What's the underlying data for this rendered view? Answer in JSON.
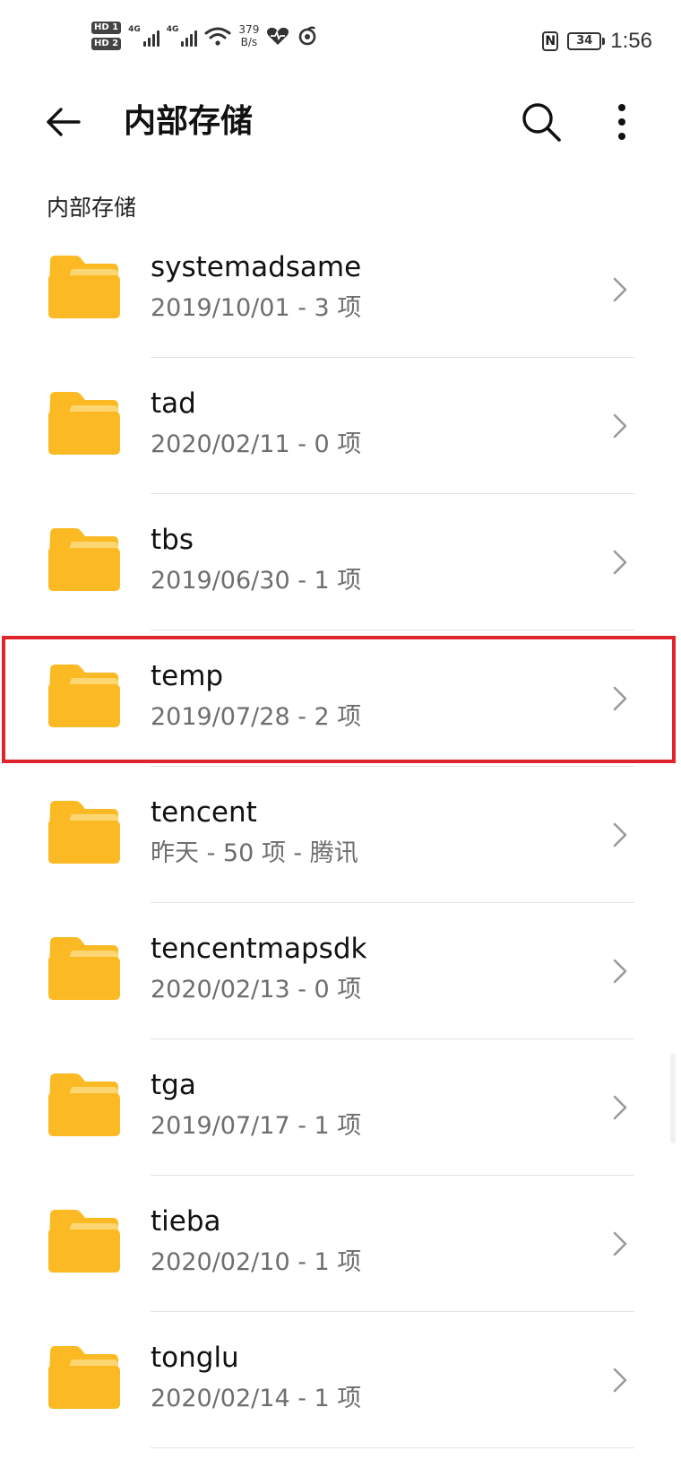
{
  "status_bar": {
    "hd1": "HD 1",
    "hd2": "HD 2",
    "signal1_label": "4G",
    "signal2_label": "4G",
    "net_speed_value": "379",
    "net_speed_unit": "B/s",
    "battery": "34",
    "time": "1:56"
  },
  "header": {
    "title": "内部存储"
  },
  "breadcrumb": "内部存储",
  "colors": {
    "folder": "#FBBA23",
    "folder_tab": "#FCD672",
    "highlight": "#E0242B"
  },
  "folders": [
    {
      "name": "systemadsame",
      "meta": "2019/10/01 - 3 项"
    },
    {
      "name": "tad",
      "meta": "2020/02/11 - 0 项"
    },
    {
      "name": "tbs",
      "meta": "2019/06/30 - 1 项"
    },
    {
      "name": "temp",
      "meta": "2019/07/28 - 2 项",
      "highlighted": true
    },
    {
      "name": "tencent",
      "meta": "昨天 - 50 项 - 腾讯"
    },
    {
      "name": "tencentmapsdk",
      "meta": "2020/02/13 - 0 项"
    },
    {
      "name": "tga",
      "meta": "2019/07/17 - 1 项"
    },
    {
      "name": "tieba",
      "meta": "2020/02/10 - 1 项"
    },
    {
      "name": "tonglu",
      "meta": "2020/02/14 - 1 项"
    }
  ],
  "icons": {
    "back": "back-arrow-icon",
    "search": "search-icon",
    "more": "more-vertical-icon",
    "folder": "folder-icon",
    "chevron": "chevron-right-icon"
  }
}
